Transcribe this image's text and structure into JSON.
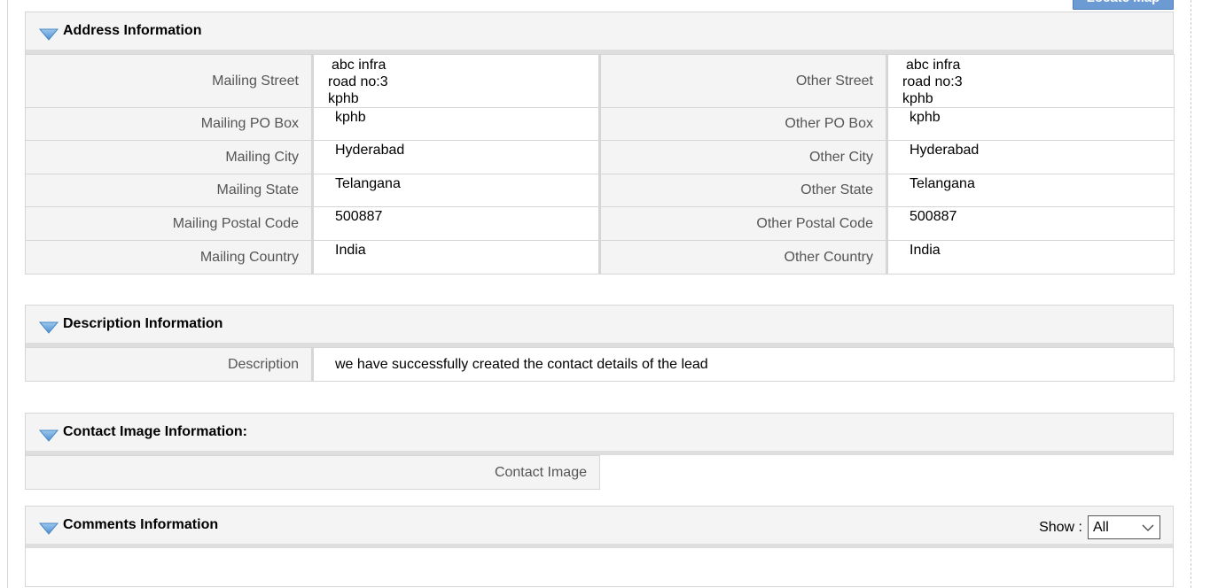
{
  "header": {
    "locate_map_label": "Locate Map"
  },
  "address": {
    "title": "Address Information",
    "rows": [
      {
        "left_label": "Mailing Street",
        "left_lines": [
          " abc infra",
          "road no:3",
          "kphb"
        ],
        "right_label": "Other Street",
        "right_lines": [
          " abc infra",
          "road no:3",
          "kphb"
        ]
      },
      {
        "left_label": "Mailing PO Box",
        "left_value": "kphb",
        "right_label": "Other PO Box",
        "right_value": "kphb"
      },
      {
        "left_label": "Mailing City",
        "left_value": "Hyderabad",
        "right_label": "Other City",
        "right_value": "Hyderabad"
      },
      {
        "left_label": "Mailing State",
        "left_value": "Telangana",
        "right_label": "Other State",
        "right_value": "Telangana"
      },
      {
        "left_label": "Mailing Postal Code",
        "left_value": "500887",
        "right_label": "Other Postal Code",
        "right_value": "500887"
      },
      {
        "left_label": "Mailing Country",
        "left_value": "India",
        "right_label": "Other Country",
        "right_value": "India"
      }
    ]
  },
  "description": {
    "title": "Description Information",
    "label": "Description",
    "value": "we have successfully created the contact details of the lead"
  },
  "contact_image": {
    "title": "Contact Image Information:",
    "label": "Contact Image"
  },
  "comments": {
    "title": "Comments Information",
    "show_label": "Show :",
    "show_selected": "All"
  },
  "icons": {
    "section_toggle": "triangle-down-icon",
    "select_arrow": "chevron-down-icon"
  },
  "colors": {
    "toggle_blue": "#6aa6d9",
    "header_bg": "#f4f4f4",
    "border": "#d6d6d6",
    "label_text": "#555555",
    "button_bg": "#6c9bd4"
  }
}
